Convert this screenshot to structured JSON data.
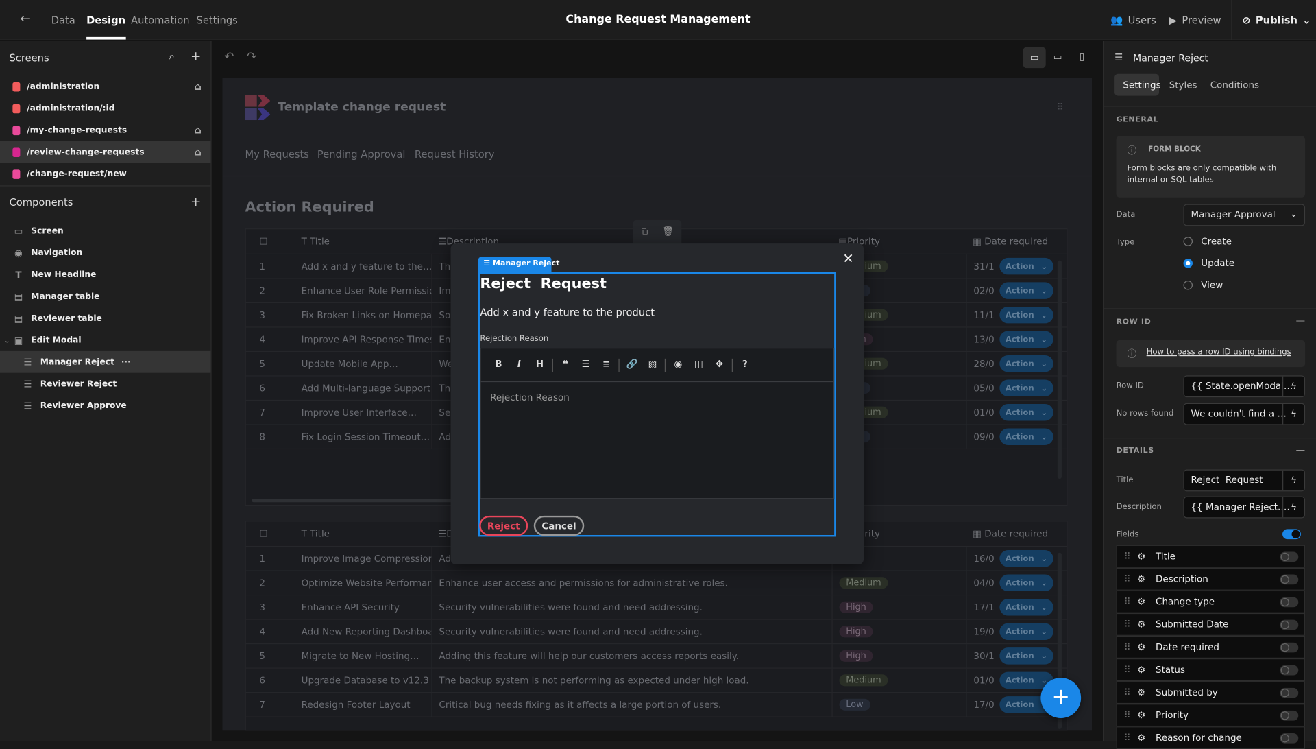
{
  "topbar": {
    "tabs": [
      "Data",
      "Design",
      "Automation",
      "Settings"
    ],
    "active_tab": "Design",
    "title": "Change Request Management",
    "users": "Users",
    "preview": "Preview",
    "publish": "Publish"
  },
  "screens": {
    "header": "Screens",
    "items": [
      {
        "route": "/administration",
        "color": "#f25c5c",
        "home": true
      },
      {
        "route": "/administration/:id",
        "color": "#f25c5c",
        "home": false
      },
      {
        "route": "/my-change-requests",
        "color": "#e94a9a",
        "home": true
      },
      {
        "route": "/review-change-requests",
        "color": "#d6268f",
        "home": true,
        "selected": true
      },
      {
        "route": "/change-request/new",
        "color": "#e94a9a",
        "home": false
      }
    ]
  },
  "components": {
    "header": "Components",
    "items": [
      {
        "label": "Screen",
        "icon": "screen-icon",
        "indent": 0
      },
      {
        "label": "Navigation",
        "icon": "eye-icon",
        "indent": 0
      },
      {
        "label": "New Headline",
        "icon": "text-icon",
        "indent": 0
      },
      {
        "label": "Manager table",
        "icon": "table-icon",
        "indent": 0
      },
      {
        "label": "Reviewer table",
        "icon": "table-icon",
        "indent": 0
      },
      {
        "label": "Edit Modal",
        "icon": "modal-icon",
        "indent": 0
      },
      {
        "label": "Manager Reject",
        "icon": "form-icon",
        "indent": 1,
        "selected": true
      },
      {
        "label": "Reviewer Reject",
        "icon": "form-icon",
        "indent": 1
      },
      {
        "label": "Reviewer Approve",
        "icon": "form-icon",
        "indent": 1
      }
    ]
  },
  "preview": {
    "app_title": "Template change request",
    "nav": [
      "My Requests",
      "Pending Approval",
      "Request History"
    ],
    "heading": "Action Required",
    "columns": {
      "title": "Title",
      "description": "Description",
      "priority": "Priority",
      "date": "Date required"
    },
    "action_label": "Action",
    "table1": [
      [
        "1",
        "Add x and y feature to the…",
        "Thi",
        "Medium",
        "31/1"
      ],
      [
        "2",
        "Enhance User Role Permissions",
        "Imp",
        "Low",
        "02/0"
      ],
      [
        "3",
        "Fix Broken Links on Homepage",
        "Sor",
        "Medium",
        "11/1"
      ],
      [
        "4",
        "Improve API Response Times",
        "Enh",
        "High",
        "13/0"
      ],
      [
        "5",
        "Update Mobile App…",
        "We",
        "Medium",
        "28/0"
      ],
      [
        "6",
        "Add Multi-language Support",
        "The",
        "Low",
        "05/0"
      ],
      [
        "7",
        "Improve User Interface…",
        "Sec",
        "Medium",
        "01/0"
      ],
      [
        "8",
        "Fix Login Session Timeout…",
        "Add",
        "Low",
        "09/0"
      ]
    ],
    "table2": [
      [
        "1",
        "Improve Image Compression",
        "Add",
        "",
        "16/0"
      ],
      [
        "2",
        "Optimize Website Performance",
        "Enhance user access and permissions for administrative roles.",
        "Medium",
        "04/0"
      ],
      [
        "3",
        "Enhance API Security",
        "Security vulnerabilities were found and need addressing.",
        "High",
        "17/1"
      ],
      [
        "4",
        "Add New Reporting Dashboard",
        "Security vulnerabilities were found and need addressing.",
        "High",
        "19/0"
      ],
      [
        "5",
        "Migrate to New Hosting…",
        "Adding this feature will help our customers access reports easily.",
        "High",
        "30/1"
      ],
      [
        "6",
        "Upgrade Database to v12.3",
        "The backup system is not performing as expected under high load.",
        "Medium",
        "01/0"
      ],
      [
        "7",
        "Redesign Footer Layout",
        "Critical bug needs fixing as it affects a large portion of users.",
        "Low",
        "17/0"
      ]
    ]
  },
  "modal": {
    "block_label": "Manager Reject",
    "title": "Reject  Request",
    "description": "Add x and y feature to the product",
    "field_label": "Rejection Reason",
    "placeholder": "Rejection Reason",
    "reject": "Reject",
    "cancel": "Cancel"
  },
  "panel": {
    "title": "Manager Reject",
    "tabs": [
      "Settings",
      "Styles",
      "Conditions"
    ],
    "general": "GENERAL",
    "info_title": "FORM BLOCK",
    "info_text": "Form blocks are only compatible with internal or SQL tables",
    "data_label": "Data",
    "data_value": "Manager Approval",
    "type_label": "Type",
    "types": [
      "Create",
      "Update",
      "View"
    ],
    "type_selected": "Update",
    "rowid_section": "ROW ID",
    "rowid_link": "How to pass a row ID using bindings",
    "rowid_label": "Row ID",
    "rowid_value": "{{ State.openModal…",
    "norows_label": "No rows found",
    "norows_value": "We couldn't find a …",
    "details": "DETAILS",
    "title_label": "Title",
    "title_value": "Reject  Request",
    "desc_label": "Description",
    "desc_value": "{{ Manager Reject.…",
    "fields_label": "Fields",
    "fields_enabled": true,
    "fields": [
      "Title",
      "Description",
      "Change type",
      "Submitted Date",
      "Date required",
      "Status",
      "Submitted by",
      "Priority",
      "Reason for change"
    ]
  },
  "colors": {
    "accent": "#1a87e8",
    "reject": "#e8455a"
  }
}
